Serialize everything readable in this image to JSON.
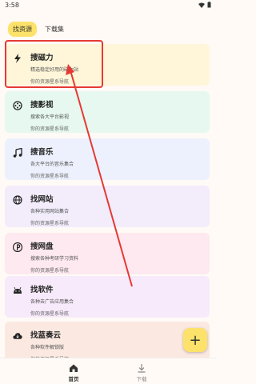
{
  "status": {
    "time": "3:58"
  },
  "tabs": [
    {
      "label": "找资源",
      "active": true
    },
    {
      "label": "下载集",
      "active": false
    }
  ],
  "cards": [
    {
      "title": "搜磁力",
      "desc": "精选稳定好用的磁力站",
      "hint": "你的资源星系导航",
      "bg": "#fff6d9",
      "icon": "lightning-icon"
    },
    {
      "title": "搜影视",
      "desc": "搜索各大平台影视",
      "hint": "你的资源星系导航",
      "bg": "#e6f8ef",
      "icon": "film-reel-icon"
    },
    {
      "title": "搜音乐",
      "desc": "各大平台的音乐集合",
      "hint": "你的资源星系导航",
      "bg": "#edf1fd",
      "icon": "music-note-icon"
    },
    {
      "title": "找网站",
      "desc": "各种实用网站集合",
      "hint": "你的资源星系导航",
      "bg": "#f2ecfb",
      "icon": "globe-icon"
    },
    {
      "title": "搜网盘",
      "desc": "搜索各种考研学习资料",
      "hint": "你的资源星系导航",
      "bg": "#fde9ef",
      "icon": "pinterest-p-icon"
    },
    {
      "title": "找软件",
      "desc": "各种去广告应用集合",
      "hint": "你的资源星系导航",
      "bg": "#f7eafa",
      "icon": "android-icon"
    },
    {
      "title": "找蓝奏云",
      "desc": "各种软件解锁版",
      "hint": "你的资源星系导航",
      "bg": "#fbe9e1",
      "icon": "cloud-download-icon"
    }
  ],
  "fab": {
    "label": "+"
  },
  "nav": {
    "home_label": "首页",
    "download_label": "下载"
  },
  "colors": {
    "accent": "#fce26a",
    "highlight": "#e53935",
    "background": "#fffaf6"
  }
}
